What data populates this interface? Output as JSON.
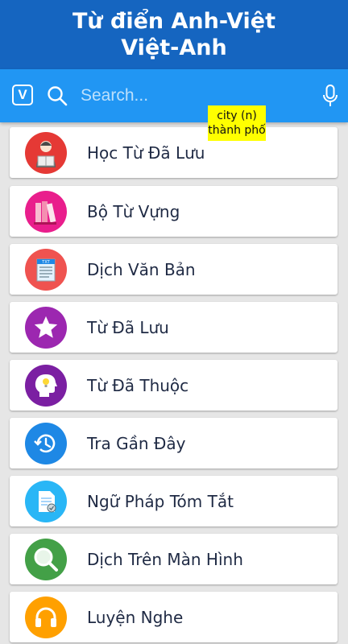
{
  "header": {
    "title_line1": "Từ điển Anh-Việt",
    "title_line2": "Việt-Anh",
    "background": "#1565c0"
  },
  "search": {
    "app_icon_letter": "V",
    "placeholder": "Search...",
    "background": "#2196f3"
  },
  "tooltip": {
    "word": "city (n)",
    "meaning": "thành phố"
  },
  "menu": {
    "items": [
      {
        "label": "Học Từ Đã Lưu",
        "icon": "reading-person-icon",
        "color": "#e53935"
      },
      {
        "label": "Bộ Từ Vựng",
        "icon": "books-icon",
        "color": "#e91e8c"
      },
      {
        "label": "Dịch Văn Bản",
        "icon": "text-document-icon",
        "color": "#ef5350"
      },
      {
        "label": "Từ Đã Lưu",
        "icon": "star-icon",
        "color": "#9c27b0"
      },
      {
        "label": "Từ Đã Thuộc",
        "icon": "head-idea-icon",
        "color": "#7b1fa2"
      },
      {
        "label": "Tra Gần Đây",
        "icon": "history-clock-icon",
        "color": "#1e88e5"
      },
      {
        "label": "Ngữ Pháp Tóm Tắt",
        "icon": "grammar-document-icon",
        "color": "#29b6f6"
      },
      {
        "label": "Dịch Trên Màn Hình",
        "icon": "magnifier-icon",
        "color": "#43a047"
      },
      {
        "label": "Luyện Nghe",
        "icon": "headphones-icon",
        "color": "#ffa000"
      }
    ]
  }
}
